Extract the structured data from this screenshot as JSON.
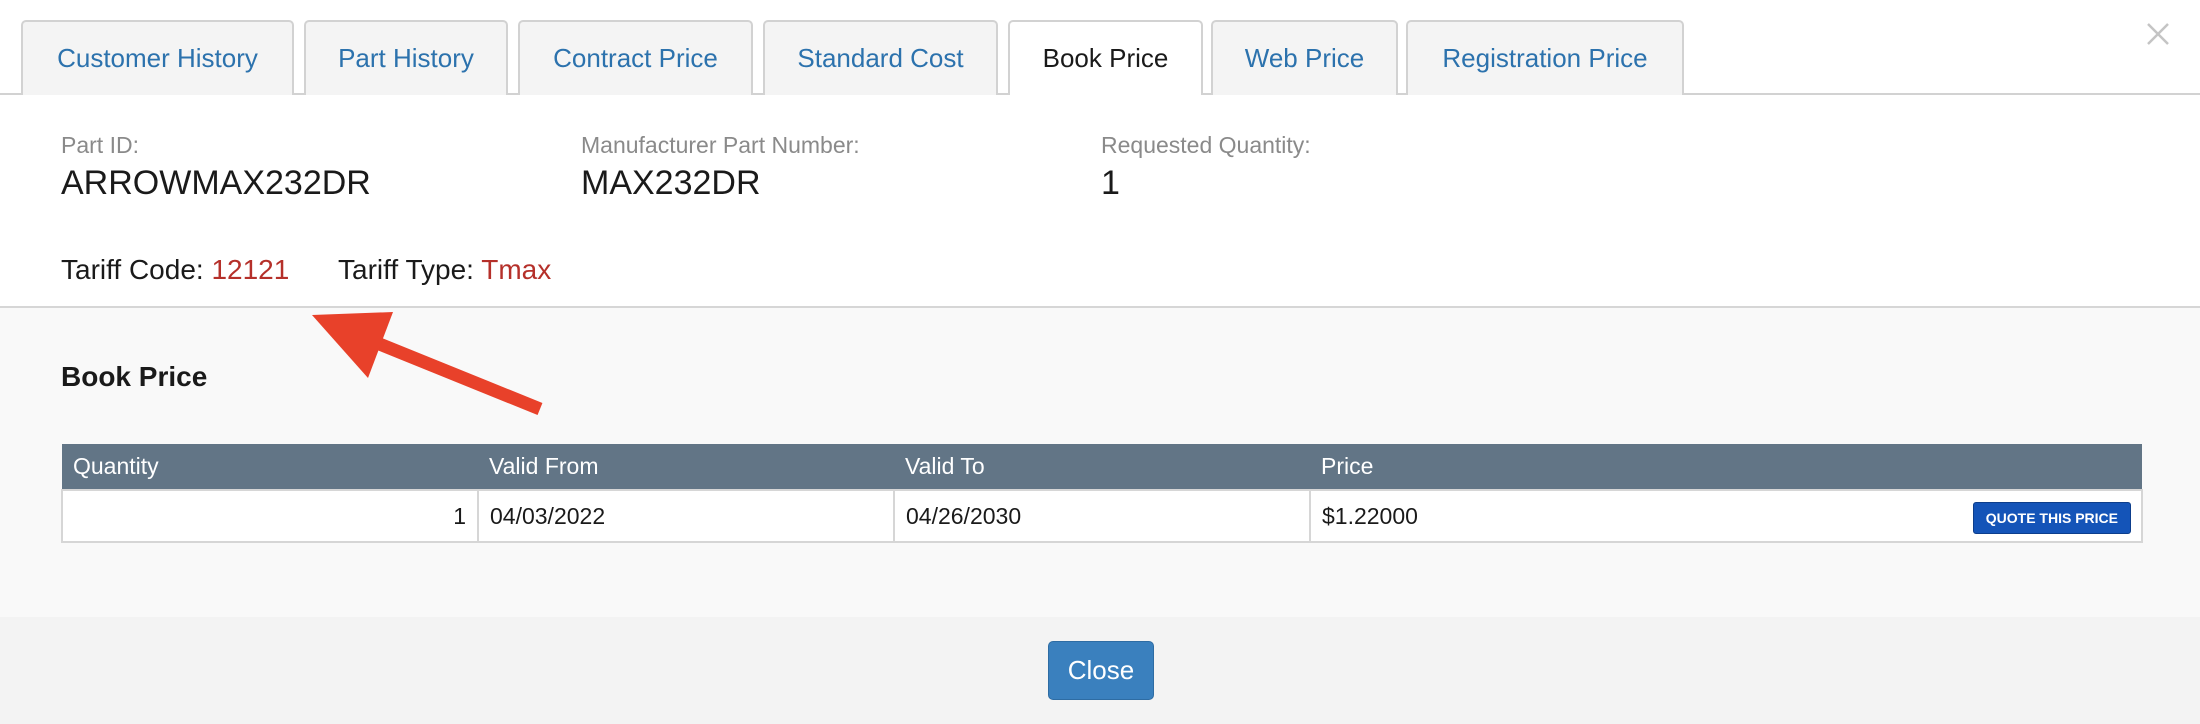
{
  "tabs": [
    {
      "label": "Customer History",
      "active": false
    },
    {
      "label": "Part History",
      "active": false
    },
    {
      "label": "Contract Price",
      "active": false
    },
    {
      "label": "Standard Cost",
      "active": false
    },
    {
      "label": "Book Price",
      "active": true
    },
    {
      "label": "Web Price",
      "active": false
    },
    {
      "label": "Registration Price",
      "active": false
    }
  ],
  "info": {
    "part_id_label": "Part ID:",
    "part_id": "ARROWMAX232DR",
    "mpn_label": "Manufacturer Part Number:",
    "mpn": "MAX232DR",
    "qty_label": "Requested Quantity:",
    "qty": "1",
    "tariff_code_label": "Tariff Code:",
    "tariff_code": "12121",
    "tariff_type_label": "Tariff Type:",
    "tariff_type": "Tmax"
  },
  "book_price": {
    "title": "Book Price",
    "columns": [
      "Quantity",
      "Valid From",
      "Valid To",
      "Price"
    ],
    "rows": [
      {
        "quantity": "1",
        "valid_from": "04/03/2022",
        "valid_to": "04/26/2030",
        "price": "$1.22000"
      }
    ],
    "quote_label": "QUOTE THIS PRICE"
  },
  "footer": {
    "close_label": "Close"
  },
  "colors": {
    "link": "#2c72ad",
    "tariff_value": "#b5302a",
    "table_header": "#627586",
    "quote_button": "#1454b8",
    "close_button": "#3a80be",
    "annotation_arrow": "#e8412a"
  },
  "icons": {
    "dialog_close": "close-icon",
    "annotation": "arrow-annotation-icon"
  }
}
